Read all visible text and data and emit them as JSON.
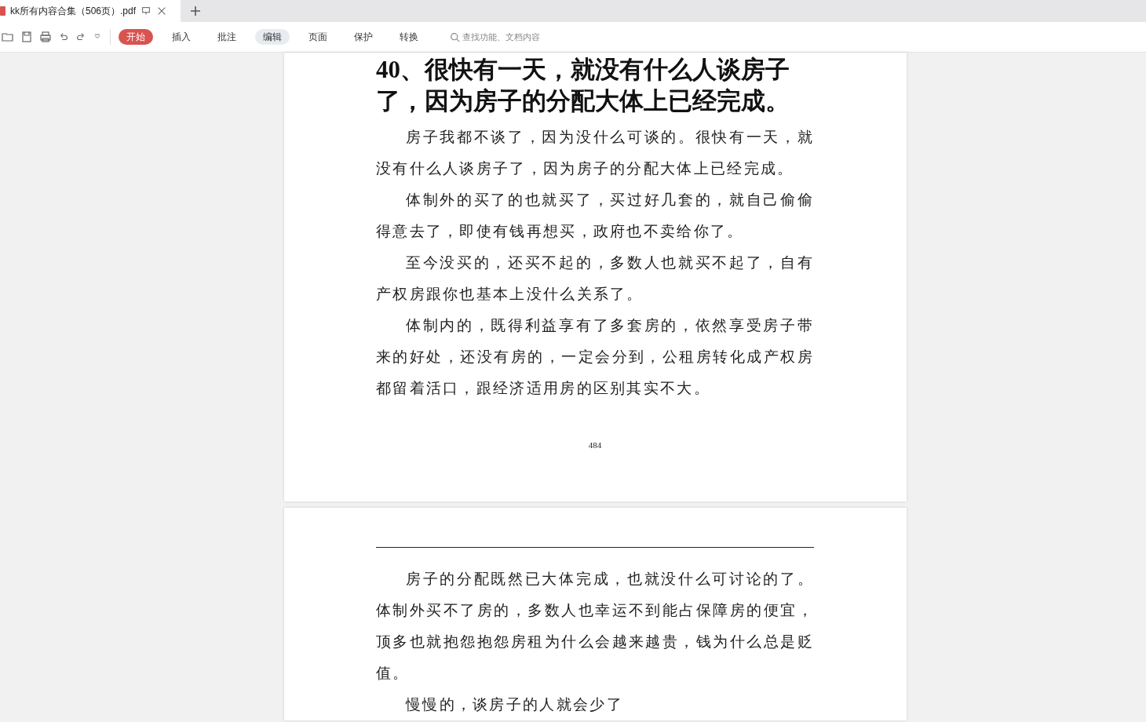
{
  "tab": {
    "title": "kk所有内容合集（506页）.pdf"
  },
  "toolbar": {
    "menus": [
      {
        "label": "开始",
        "selected": true
      },
      {
        "label": "插入",
        "selected": false
      },
      {
        "label": "批注",
        "selected": false
      },
      {
        "label": "编辑",
        "selected": false,
        "hover": true
      },
      {
        "label": "页面",
        "selected": false
      },
      {
        "label": "保护",
        "selected": false
      },
      {
        "label": "转换",
        "selected": false
      }
    ],
    "search": {
      "placeholder": "查找功能、文档内容"
    }
  },
  "pages": [
    {
      "heading": "40、很快有一天，就没有什么人谈房子了，因为房子的分配大体上已经完成。",
      "paragraphs": [
        "房子我都不谈了，因为没什么可谈的。很快有一天，就没有什么人谈房子了，因为房子的分配大体上已经完成。",
        "体制外的买了的也就买了，买过好几套的，就自己偷偷得意去了，即使有钱再想买，政府也不卖给你了。",
        "至今没买的，还买不起的，多数人也就买不起了，自有产权房跟你也基本上没什么关系了。",
        "体制内的，既得利益享有了多套房的，依然享受房子带来的好处，还没有房的，一定会分到，公租房转化成产权房都留着活口，跟经济适用房的区别其实不大。"
      ],
      "page_number": "484"
    },
    {
      "paragraphs": [
        "房子的分配既然已大体完成，也就没什么可讨论的了。体制外买不了房的，多数人也幸运不到能占保障房的便宜，顶多也就抱怨抱怨房租为什么会越来越贵，钱为什么总是贬值。",
        "慢慢的，谈房子的人就会少了"
      ]
    }
  ]
}
